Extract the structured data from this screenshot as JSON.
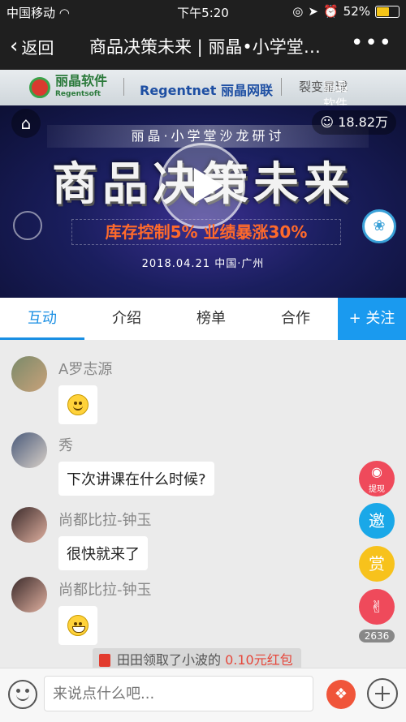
{
  "status_bar": {
    "carrier": "中国移动",
    "wifi_icon": "wifi-icon",
    "time": "下午5:20",
    "battery": "52%"
  },
  "nav": {
    "back_label": "返回",
    "title": "商品决策未来 | 丽晶•小学堂沙龙研讨",
    "more_label": "•••"
  },
  "sponsors": {
    "logo1_name": "丽晶软件",
    "logo1_sub": "Regentsoft",
    "logo2_name": "Regentnet 丽晶网联",
    "logo3_name": "裂变星球",
    "logo3_overlay": "丽晶软件"
  },
  "banner": {
    "subtitle": "丽晶·小学堂沙龙研讨",
    "title": "商品决策未来",
    "slogan": "库存控制5%  业绩暴涨30%",
    "date_place": "2018.04.21  中国·广州",
    "views": "18.82万"
  },
  "tabs": [
    {
      "label": "互动",
      "active": true
    },
    {
      "label": "介绍",
      "active": false
    },
    {
      "label": "榜单",
      "active": false
    },
    {
      "label": "合作",
      "active": false
    }
  ],
  "follow_label": "+ 关注",
  "messages": [
    {
      "name": "A罗志源",
      "text": "",
      "type": "emoji-smile"
    },
    {
      "name": "秀",
      "text": "下次讲课在什么时候?",
      "type": "text"
    },
    {
      "name": "尚都比拉-钟玉",
      "text": "很快就来了",
      "type": "text"
    },
    {
      "name": "尚都比拉-钟玉",
      "text": "",
      "type": "emoji-grin"
    }
  ],
  "notice": {
    "prefix": "田田领取了小波的 ",
    "amount": "0.10元红包"
  },
  "float_buttons": {
    "withdraw_label": "提现",
    "invite_label": "邀",
    "reward_label": "赏",
    "like_count": "2636"
  },
  "input": {
    "placeholder": "来说点什么吧..."
  },
  "colors": {
    "accent": "#1a8fe3",
    "follow_bg": "#1a9aef",
    "withdraw": "#ef4a5b",
    "invite": "#1aa8e8",
    "reward": "#f7c21c",
    "like": "#ef4a5b"
  }
}
